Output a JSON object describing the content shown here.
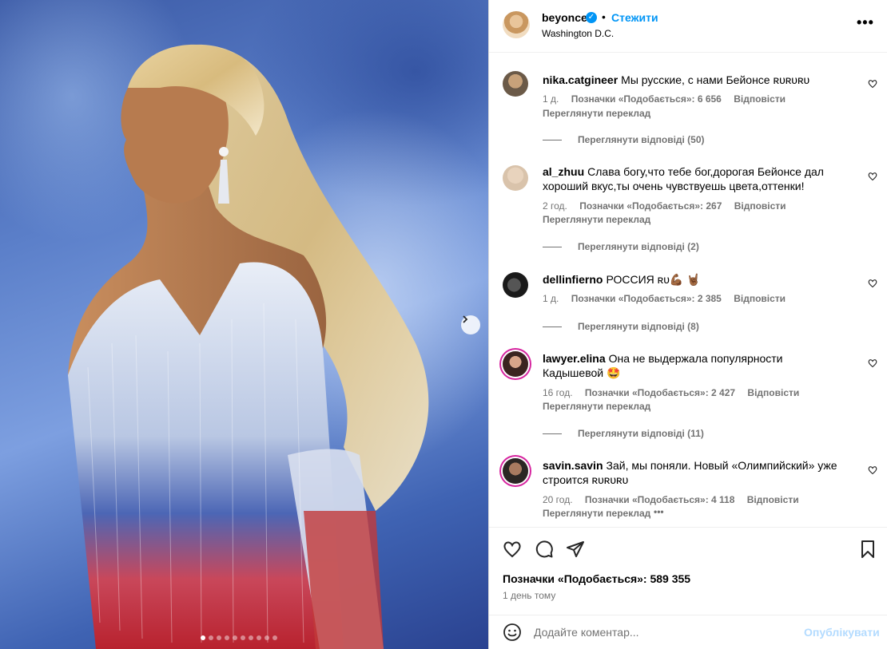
{
  "post": {
    "username": "beyonce",
    "verified_icon": "verified-badge-icon",
    "separator": "•",
    "follow_label": "Стежити",
    "location": "Washington D.C.",
    "more_label": "•••"
  },
  "photo": {
    "slide_count": 10,
    "active_slide": 1
  },
  "comments": [
    {
      "username": "nika.catgineer",
      "text": "Мы русские, с нами Бейонсе ʀᴜʀᴜʀᴜ",
      "age": "1 д.",
      "likes": "Позначки «Подобається»: 6 656",
      "reply": "Відповісти",
      "translation": "Переглянути переклад",
      "replies": "Переглянути відповіді (50)"
    },
    {
      "username": "al_zhuu",
      "text": "Слава богу,что тебе бог,дорогая Бейонсе дал хороший вкус,ты очень чувствуешь цвета,оттенки!",
      "age": "2 год.",
      "likes": "Позначки «Подобається»: 267",
      "reply": "Відповісти",
      "translation": "Переглянути переклад",
      "replies": "Переглянути відповіді (2)"
    },
    {
      "username": "dellinfierno",
      "text": "РОССИЯ ʀᴜ💪🏾 🤘🏾",
      "age": "1 д.",
      "likes": "Позначки «Подобається»: 2 385",
      "reply": "Відповісти",
      "replies": "Переглянути відповіді (8)"
    },
    {
      "username": "lawyer.elina",
      "text": "Она не выдержала популярности Кадышевой 🤩",
      "age": "16 год.",
      "likes": "Позначки «Подобається»: 2 427",
      "reply": "Відповісти",
      "translation": "Переглянути переклад",
      "replies": "Переглянути відповіді (11)"
    },
    {
      "username": "savin.savin",
      "text": "Зай, мы поняли. Новый «Олимпийский» уже строится ʀᴜʀᴜʀᴜ",
      "age": "20 год.",
      "likes": "Позначки «Подобається»: 4 118",
      "reply": "Відповісти",
      "translation": "Переглянути переклад",
      "more": "•••"
    }
  ],
  "actions": {
    "likes_total": "Позначки «Подобається»: 589 355",
    "time_ago": "1 день тому"
  },
  "composer": {
    "placeholder": "Додайте коментар...",
    "publish_label": "Опублікувати"
  },
  "colors": {
    "accent": "#0095f6",
    "muted": "#737373",
    "publish_disabled": "#b3dbff",
    "story_ring": "#d6249f"
  }
}
